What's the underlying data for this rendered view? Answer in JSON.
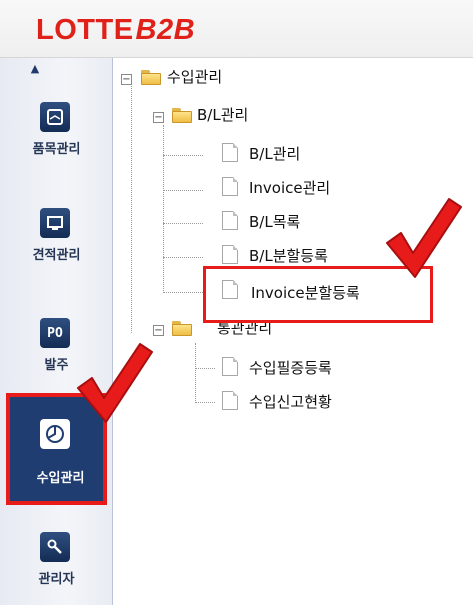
{
  "app": {
    "logo_text": "LOTTE",
    "logo_accent": "B2B"
  },
  "sidebar": {
    "items": [
      {
        "key": "items",
        "label": "품목관리",
        "icon": "envelope-icon"
      },
      {
        "key": "quote",
        "label": "견적관리",
        "icon": "monitor-icon"
      },
      {
        "key": "po",
        "label": "발주",
        "icon_text": "PO"
      },
      {
        "key": "import",
        "label": "수입관리",
        "icon": "pie-chart-icon",
        "selected": true
      },
      {
        "key": "admin",
        "label": "관리자",
        "icon": "wrench-icon"
      }
    ]
  },
  "tree": {
    "root": "수입관리",
    "bl_folder": "B/L관리",
    "bl_children": [
      "B/L관리",
      "Invoice관리",
      "B/L목록",
      "B/L분할등록",
      "Invoice분할등록"
    ],
    "customs_folder": "통관관리",
    "customs_children": [
      "수입필증등록",
      "수입신고현황"
    ]
  },
  "colors": {
    "brand": "#e0211a",
    "nav_dark": "#1f3d70",
    "highlight": "#e81b1b"
  }
}
